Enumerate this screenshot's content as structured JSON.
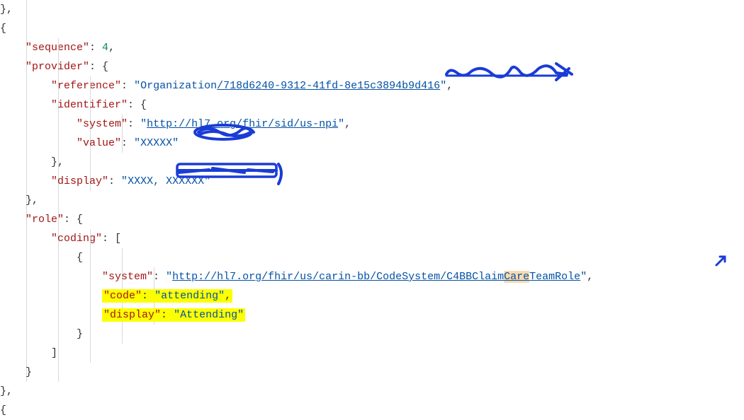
{
  "code": {
    "seq_key": "\"sequence\"",
    "seq_val": "4",
    "provider_key": "\"provider\"",
    "reference_key": "\"reference\"",
    "reference_val_q1": "\"",
    "reference_val_text": "Organization",
    "reference_val_link": "/718d6240-9312-41fd-8e1",
    "reference_val_scribbled": "5c3894b9d416",
    "reference_val_q2": "\"",
    "identifier_key": "\"identifier\"",
    "system_key": "\"system\"",
    "system_val_q1": "\"",
    "system_val_link": "http://hl7.org/fhir/sid/us-npi",
    "system_val_q2": "\"",
    "value_key": "\"value\"",
    "value_val_q1": "\"",
    "value_val_scribbled": "XXXXX",
    "value_val_q2": "\"",
    "display_key": "\"display\"",
    "display_val_q1": "\"",
    "display_val_scribbled": "XXXX, XXXXXX",
    "display_val_q2": "\"",
    "role_key": "\"role\"",
    "coding_key": "\"coding\"",
    "role_system_key": "\"system\"",
    "role_system_val_q1": "\"",
    "role_system_link_a": "http://hl7.org/fhir/us/carin-bb/CodeSystem/C4BBClaim",
    "role_system_care": "Care",
    "role_system_link_b": "TeamRole",
    "role_system_val_q2": "\"",
    "code_key": "\"code\"",
    "code_val": "\"attending\"",
    "display2_key": "\"display\"",
    "display2_val": "\"Attending\""
  }
}
